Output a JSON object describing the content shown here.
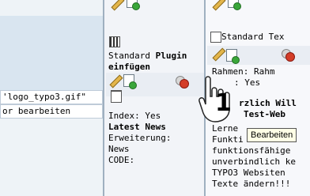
{
  "left_column": {
    "logo_field_value": "'logo_typo3.gif\"",
    "edit_link": "or bearbeiten"
  },
  "middle_column": {
    "content_type": "Standard",
    "content_type_bold": "Plugin",
    "content_type_line2": "einfügen",
    "index_label": "Index: Yes",
    "title": "Latest News",
    "extension_label": "Erweiterung:",
    "extension_value": "News",
    "code_label": "CODE:"
  },
  "right_column": {
    "content_type": "Standard Tex",
    "frame_label": "Rahmen: Rahm",
    "index_label": ": Yes",
    "heading_line1": "rzlich Will",
    "heading_line2": "Test-Web",
    "body_lines": [
      "Lerne",
      "Funkti",
      "funktionsfähige",
      "unverbindlich ke",
      "TYPO3 Websiten",
      "Texte ändern!!!"
    ]
  },
  "tooltip": {
    "text": "Bearbeiten"
  },
  "step_number": "1"
}
